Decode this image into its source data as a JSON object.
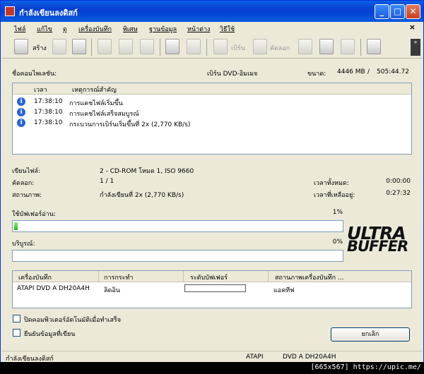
{
  "window": {
    "title": "กำลังเขียนลงดิสก์"
  },
  "menu": [
    "ไฟล์",
    "แก้ไข",
    "ดู",
    "เครื่องบันทึก",
    "พิเศษ",
    "ฐานข้อมูล",
    "หน้าต่าง",
    "วิธีใช้"
  ],
  "toolbar": {
    "new_label": "สร้าง",
    "burn_label": "เบิร์น",
    "copy_label": "คัดลอก"
  },
  "project": {
    "file_label": "ชื่อคอมไพเลชัน:",
    "burn_label": "เบิร์น DVD-อิมเมจ",
    "size_label": "ขนาด:",
    "size_value": "4446 MB",
    "sep": "/",
    "time_value": "505:44.72"
  },
  "events": {
    "col_time": "เวลา",
    "col_event": "เหตุการณ์สำคัญ",
    "rows": [
      {
        "time": "17:38:10",
        "text": "การแคชไฟล์เริ่มขึ้น"
      },
      {
        "time": "17:38:10",
        "text": "การแคชไฟล์เสร็จสมบูรณ์"
      },
      {
        "time": "17:38:10",
        "text": "กระบวนการเบิร์นเริ่มขึ้นที่ 2x (2,770 KB/s)"
      }
    ]
  },
  "status": {
    "write_file_label": "เขียนไฟล์:",
    "write_file_value": "2 - CD-ROM โหมด 1, ISO 9660",
    "copies_label": "คัดลอก:",
    "copies_value": "1 / 1",
    "state_label": "สถานภาพ:",
    "state_value": "กำลังเขียนที่ 2x (2,770 KB/s)",
    "total_time_label": "เวลาทั้งหมด:",
    "total_time_value": "0:00:00",
    "remaining_label": "เวลาที่เหลืออยู่:",
    "remaining_value": "0:27:32"
  },
  "buffer": {
    "read_label": "ใช้บัฟเฟอร์อ่าน:",
    "read_percent_text": "1%",
    "read_fraction": 0.01,
    "complete_label": "บริบูรณ์:",
    "complete_percent_text": "0%",
    "complete_fraction": 0.0
  },
  "logo": {
    "line1": "ULTRA",
    "line2": "BUFFER"
  },
  "drives": {
    "headers": [
      "เครื่องบันทึก",
      "การกระทำ",
      "ระดับบัฟเฟอร์",
      "สถานภาพเครื่องบันทึก ..."
    ],
    "rows": [
      {
        "recorder": "ATAPI DVD A  DH20A4H",
        "action": "ลิดอิน",
        "status": "แอคทีฟ",
        "buffer_fraction": 0.0
      }
    ]
  },
  "options": {
    "shutdown_label": "ปิดคอมพิวเตอร์อัตโนมัติเมื่อทำเสร็จ",
    "verify_label": "ยืนยันข้อมูลที่เขียน"
  },
  "cancel_label": "ยกเลิก",
  "statusbar": {
    "left": "กำลังเขียนลงดิสก์",
    "drive_bus": "ATAPI",
    "drive_name": "DVD A  DH20A4H"
  },
  "footer": "[665x567] https://upic.me/"
}
